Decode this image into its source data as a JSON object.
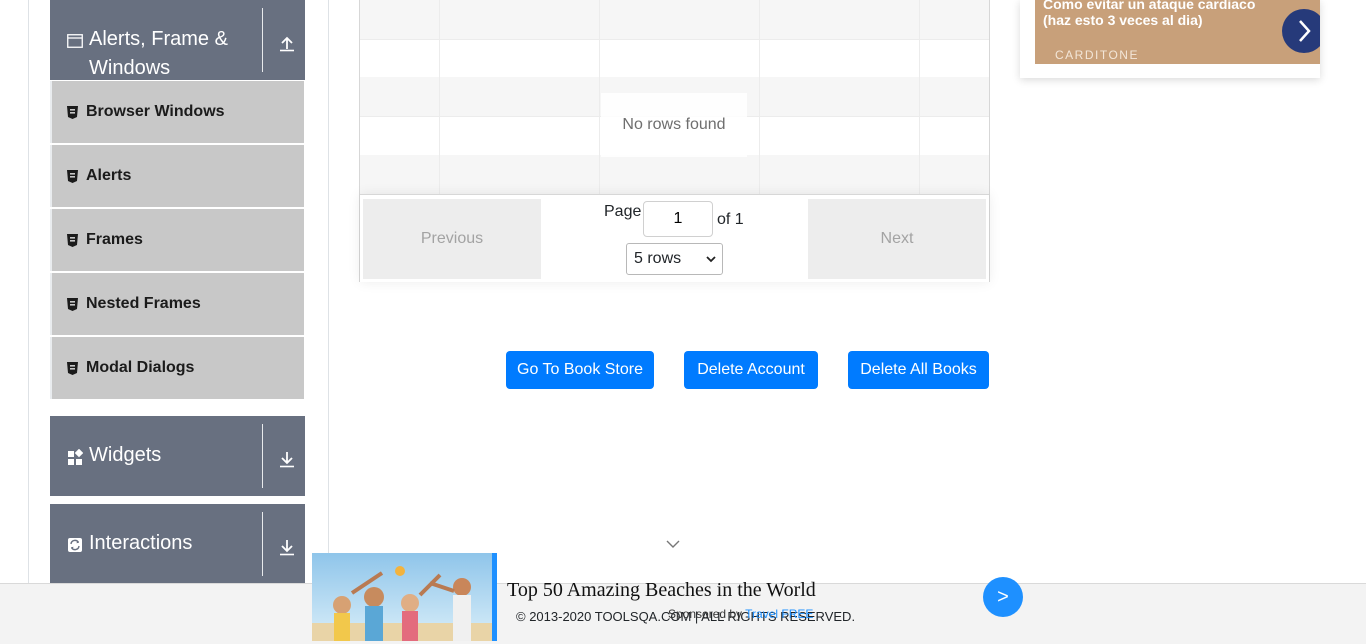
{
  "sidebar": {
    "alerts_group": {
      "title": "Alerts, Frame & Windows",
      "icon": "window-icon",
      "arrow": "arrow-up-icon"
    },
    "alerts_items": [
      {
        "label": "Browser Windows"
      },
      {
        "label": "Alerts"
      },
      {
        "label": "Frames"
      },
      {
        "label": "Nested Frames"
      },
      {
        "label": "Modal Dialogs"
      }
    ],
    "widgets_group": {
      "title": "Widgets",
      "icon": "widgets-icon",
      "arrow": "arrow-down-icon"
    },
    "interactions_group": {
      "title": "Interactions",
      "icon": "interactions-icon",
      "arrow": "arrow-down-icon"
    }
  },
  "table": {
    "empty_message": "No rows found",
    "previous_label": "Previous",
    "next_label": "Next",
    "page_label": "Page",
    "page_value": "1",
    "of_label": "of 1",
    "rows_select": "5 rows"
  },
  "actions": {
    "go_to_book_store": "Go To Book Store",
    "delete_account": "Delete Account",
    "delete_all_books": "Delete All Books"
  },
  "top_ad": {
    "headline": "Como evitar un ataque cardiaco (haz esto 3 veces al dia)",
    "brand": "CARDITONE"
  },
  "bottom_ad": {
    "headline": "Top 50 Amazing Beaches in the World",
    "sponsor_prefix": "Sponsored by ",
    "sponsor_name": "Travel FREE",
    "go_label": ">"
  },
  "footer": {
    "copyright": "© 2013-2020 TOOLSQA.COM | ALL RIGHTS RESERVED."
  },
  "colors": {
    "group_header": "#687080",
    "sub_item": "#c8c8c8",
    "primary": "#007bff",
    "ad_bg": "#c8a07a",
    "ad_button": "#263a7a",
    "sponsor_link": "#1e90ff"
  }
}
